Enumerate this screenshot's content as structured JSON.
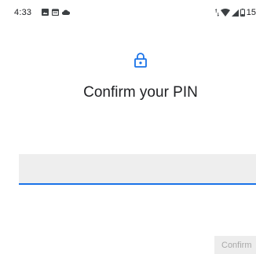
{
  "status_bar": {
    "time": "4:33",
    "left_icons": [
      "image-notification-icon",
      "calendar-notification-icon",
      "cloud-notification-icon"
    ],
    "right_icons": [
      "data-arrows-icon",
      "wifi-icon",
      "cellular-signal-icon",
      "battery-icon"
    ],
    "battery_text": "15"
  },
  "screen": {
    "lock_icon": "lock-icon",
    "title": "Confirm your PIN",
    "pin_input_value": "",
    "confirm_label": "Confirm"
  },
  "colors": {
    "accent": "#1a73e8",
    "text": "#202124",
    "field_background": "#eeeeee",
    "disabled_button_background": "#ededed",
    "disabled_button_text": "#a9a9a9"
  }
}
